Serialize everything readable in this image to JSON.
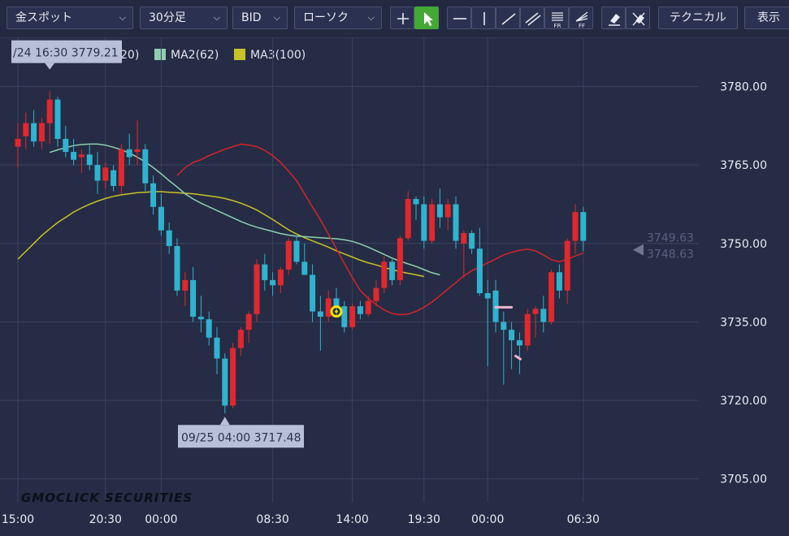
{
  "toolbar": {
    "symbol": "金スポット",
    "timeframe": "30分足",
    "price_type": "BID",
    "chart_style": "ローソク",
    "technical_label": "テクニカル",
    "display_label": "表示",
    "icons": [
      "crosshair-icon",
      "pointer-icon",
      "horizontal-line-icon",
      "vertical-line-icon",
      "trend-line-icon",
      "parallel-channel-icon",
      "fibonacci-retracement-icon",
      "fibonacci-fan-icon",
      "eraser-icon",
      "erase-all-icon"
    ]
  },
  "legend": {
    "items": [
      {
        "label": "MA1(20)",
        "color": "#d8232a"
      },
      {
        "label": "MA2(62)",
        "color": "#8fcfb0"
      },
      {
        "label": "MA3(100)",
        "color": "#c9c227"
      }
    ]
  },
  "watermark": "GMOCLICK SECURITIES",
  "chart_data": {
    "type": "candlestick",
    "y_ticks": [
      "3780.00",
      "3765.00",
      "3750.00",
      "3735.00",
      "3720.00",
      "3705.00"
    ],
    "y_tick_values": [
      3780,
      3765,
      3750,
      3735,
      3720,
      3705
    ],
    "ylim": [
      3700.6,
      3789.4
    ],
    "x_ticks": [
      "15:00",
      "20:30",
      "00:00",
      "08:30",
      "14:00",
      "19:30",
      "00:00",
      "06:30"
    ],
    "x_tick_index": [
      0,
      11,
      18,
      32,
      42,
      51,
      59,
      71
    ],
    "high_label": "/24 16:30 3779.21",
    "high_index": 4,
    "high_value": 3779.21,
    "low_label": "09/25 04:00 3717.48",
    "low_index": 26,
    "low_value": 3717.48,
    "last_ask": "3749.63",
    "last_bid": "3748.63",
    "last_bid_value": 3748.63,
    "up_color": "#e0282e",
    "down_color": "#2fb3cf",
    "candles": [
      [
        3768.5,
        3773.0,
        3764.5,
        3770.0
      ],
      [
        3770.5,
        3775.0,
        3768.0,
        3773.0
      ],
      [
        3773.0,
        3775.5,
        3768.5,
        3769.5
      ],
      [
        3769.5,
        3774.0,
        3768.0,
        3773.0
      ],
      [
        3773.0,
        3779.2,
        3769.0,
        3777.5
      ],
      [
        3777.5,
        3778.0,
        3768.5,
        3770.0
      ],
      [
        3770.0,
        3772.5,
        3766.5,
        3767.5
      ],
      [
        3767.5,
        3770.0,
        3765.0,
        3766.0
      ],
      [
        3766.5,
        3768.0,
        3763.5,
        3767.0
      ],
      [
        3767.0,
        3769.0,
        3764.0,
        3765.0
      ],
      [
        3765.0,
        3767.5,
        3759.5,
        3762.0
      ],
      [
        3762.0,
        3765.5,
        3760.5,
        3764.5
      ],
      [
        3764.0,
        3765.0,
        3760.0,
        3761.0
      ],
      [
        3761.0,
        3769.0,
        3759.5,
        3768.0
      ],
      [
        3768.0,
        3771.0,
        3765.0,
        3766.5
      ],
      [
        3767.5,
        3773.5,
        3765.0,
        3768.0
      ],
      [
        3768.0,
        3769.0,
        3760.0,
        3761.5
      ],
      [
        3761.5,
        3763.0,
        3755.5,
        3757.0
      ],
      [
        3757.0,
        3759.5,
        3751.5,
        3752.5
      ],
      [
        3752.5,
        3754.0,
        3748.0,
        3749.5
      ],
      [
        3749.5,
        3751.0,
        3740.0,
        3741.0
      ],
      [
        3741.0,
        3744.5,
        3738.0,
        3743.0
      ],
      [
        3743.0,
        3745.5,
        3735.0,
        3736.0
      ],
      [
        3736.0,
        3740.0,
        3733.0,
        3735.5
      ],
      [
        3735.5,
        3737.0,
        3730.5,
        3732.0
      ],
      [
        3732.0,
        3734.0,
        3725.0,
        3728.0
      ],
      [
        3728.0,
        3729.0,
        3717.5,
        3719.0
      ],
      [
        3719.0,
        3731.0,
        3718.5,
        3730.0
      ],
      [
        3730.0,
        3734.0,
        3728.5,
        3733.5
      ],
      [
        3733.5,
        3737.0,
        3731.0,
        3736.5
      ],
      [
        3736.5,
        3747.0,
        3735.0,
        3746.0
      ],
      [
        3746.0,
        3748.0,
        3741.0,
        3743.0
      ],
      [
        3743.0,
        3744.5,
        3740.0,
        3742.0
      ],
      [
        3742.0,
        3745.5,
        3740.5,
        3745.0
      ],
      [
        3745.0,
        3751.0,
        3744.0,
        3750.5
      ],
      [
        3750.5,
        3751.5,
        3746.0,
        3746.5
      ],
      [
        3746.5,
        3750.0,
        3744.0,
        3744.0
      ],
      [
        3744.0,
        3746.0,
        3735.0,
        3737.0
      ],
      [
        3737.0,
        3740.0,
        3729.5,
        3736.0
      ],
      [
        3736.0,
        3741.0,
        3735.0,
        3739.5
      ],
      [
        3739.5,
        3741.5,
        3736.0,
        3738.0
      ],
      [
        3738.0,
        3739.0,
        3733.0,
        3734.0
      ],
      [
        3734.0,
        3738.5,
        3733.5,
        3738.0
      ],
      [
        3738.0,
        3739.0,
        3735.5,
        3736.5
      ],
      [
        3736.5,
        3740.0,
        3736.0,
        3739.0
      ],
      [
        3739.0,
        3743.0,
        3738.0,
        3741.5
      ],
      [
        3741.5,
        3747.5,
        3740.5,
        3746.5
      ],
      [
        3746.5,
        3747.0,
        3742.0,
        3743.0
      ],
      [
        3743.0,
        3751.5,
        3742.0,
        3751.0
      ],
      [
        3751.0,
        3760.0,
        3750.5,
        3758.5
      ],
      [
        3758.5,
        3759.0,
        3754.5,
        3757.5
      ],
      [
        3757.5,
        3759.0,
        3749.0,
        3750.5
      ],
      [
        3750.5,
        3758.5,
        3750.0,
        3757.5
      ],
      [
        3757.5,
        3760.5,
        3753.0,
        3755.0
      ],
      [
        3755.0,
        3758.5,
        3752.5,
        3757.5
      ],
      [
        3757.5,
        3759.0,
        3749.0,
        3750.5
      ],
      [
        3750.0,
        3752.5,
        3743.5,
        3752.0
      ],
      [
        3752.0,
        3752.5,
        3748.0,
        3749.0
      ],
      [
        3749.0,
        3753.0,
        3740.0,
        3740.5
      ],
      [
        3740.5,
        3743.0,
        3726.5,
        3739.5
      ],
      [
        3741.0,
        3743.0,
        3733.0,
        3735.0
      ],
      [
        3735.0,
        3737.0,
        3723.0,
        3733.5
      ],
      [
        3733.5,
        3735.0,
        3726.0,
        3731.5
      ],
      [
        3731.5,
        3733.0,
        3725.0,
        3730.5
      ],
      [
        3730.5,
        3737.5,
        3729.5,
        3736.5
      ],
      [
        3736.5,
        3738.0,
        3732.0,
        3737.5
      ],
      [
        3737.5,
        3740.0,
        3733.0,
        3735.0
      ],
      [
        3735.0,
        3745.0,
        3734.5,
        3744.5
      ],
      [
        3744.5,
        3746.0,
        3739.5,
        3741.0
      ],
      [
        3741.0,
        3751.0,
        3738.5,
        3750.5
      ],
      [
        3750.5,
        3757.5,
        3748.0,
        3756.0
      ],
      [
        3756.0,
        3757.0,
        3748.5,
        3750.5
      ]
    ],
    "ma1": [
      3763.0,
      3764.5,
      3765.5,
      3766.0,
      3766.8,
      3767.4,
      3768.0,
      3768.5,
      3769.0,
      3768.8,
      3768.5,
      3767.8,
      3766.8,
      3765.5,
      3763.8,
      3762.0,
      3759.5,
      3757.0,
      3754.5,
      3751.8,
      3749.0,
      3746.2,
      3743.5,
      3741.0,
      3739.5,
      3738.3,
      3737.3,
      3736.6,
      3736.4,
      3736.5,
      3737.0,
      3737.8,
      3738.8,
      3740.0,
      3741.3,
      3742.5,
      3743.8,
      3744.8,
      3745.5,
      3746.3,
      3747.0,
      3747.8,
      3748.3,
      3748.7,
      3748.9,
      3748.6,
      3747.8,
      3746.9,
      3746.5,
      3747.0,
      3747.6,
      3748.2
    ],
    "ma1_start": 20,
    "ma2": [
      3764.0,
      3765.0,
      3766.0,
      3766.8,
      3767.4,
      3767.9,
      3768.3,
      3768.7,
      3768.9,
      3769.0,
      3769.0,
      3768.8,
      3768.4,
      3767.9,
      3767.3,
      3766.5,
      3765.6,
      3764.5,
      3763.3,
      3762.0,
      3760.8,
      3759.5,
      3758.5,
      3757.7,
      3757.0,
      3756.3,
      3755.6,
      3754.9,
      3754.2,
      3753.6,
      3753.1,
      3752.7,
      3752.3,
      3751.9,
      3751.6,
      3751.4,
      3751.3,
      3751.2,
      3751.1,
      3751.0,
      3750.9,
      3750.7,
      3750.4,
      3749.9,
      3749.3,
      3748.6,
      3747.9,
      3747.2,
      3746.6,
      3746.1,
      3745.6,
      3745.0,
      3744.4,
      3744.0
    ],
    "ma2_start": 0,
    "ma2_from": 4,
    "ma3": [
      3747.0,
      3748.5,
      3750.0,
      3751.5,
      3752.8,
      3754.0,
      3755.0,
      3756.0,
      3756.8,
      3757.5,
      3758.1,
      3758.6,
      3759.0,
      3759.3,
      3759.5,
      3759.7,
      3759.8,
      3759.9,
      3759.9,
      3759.8,
      3759.7,
      3759.6,
      3759.5,
      3759.3,
      3759.1,
      3758.9,
      3758.6,
      3758.2,
      3757.7,
      3757.1,
      3756.4,
      3755.5,
      3754.6,
      3753.6,
      3752.6,
      3751.8,
      3751.1,
      3750.5,
      3749.9,
      3749.3,
      3748.6,
      3748.0,
      3747.4,
      3746.8,
      3746.3,
      3745.9,
      3745.4,
      3745.0,
      3744.6,
      3744.3,
      3744.0,
      3743.7
    ]
  }
}
